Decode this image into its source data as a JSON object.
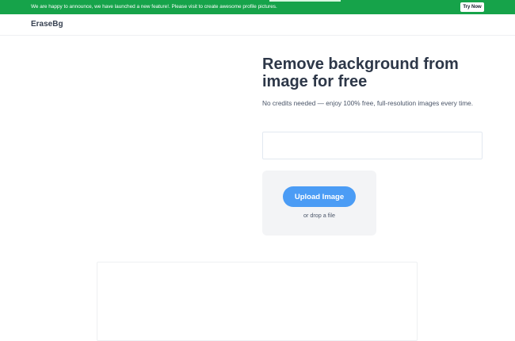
{
  "banner": {
    "message": "We are happy to announce, we have launched a new feature!. Please visit to create awesome profile pictures.",
    "cta_label": "Try Now",
    "color": "#16a34a"
  },
  "header": {
    "logo": "EraseBg"
  },
  "hero": {
    "title": "Remove background from image for free",
    "subtitle": "No credits needed — enjoy 100% free, full-resolution images every time."
  },
  "url_input": {
    "value": "",
    "placeholder": ""
  },
  "upload": {
    "button_label": "Upload Image",
    "drop_text": "or drop a file",
    "button_color": "#4b9cf5"
  }
}
